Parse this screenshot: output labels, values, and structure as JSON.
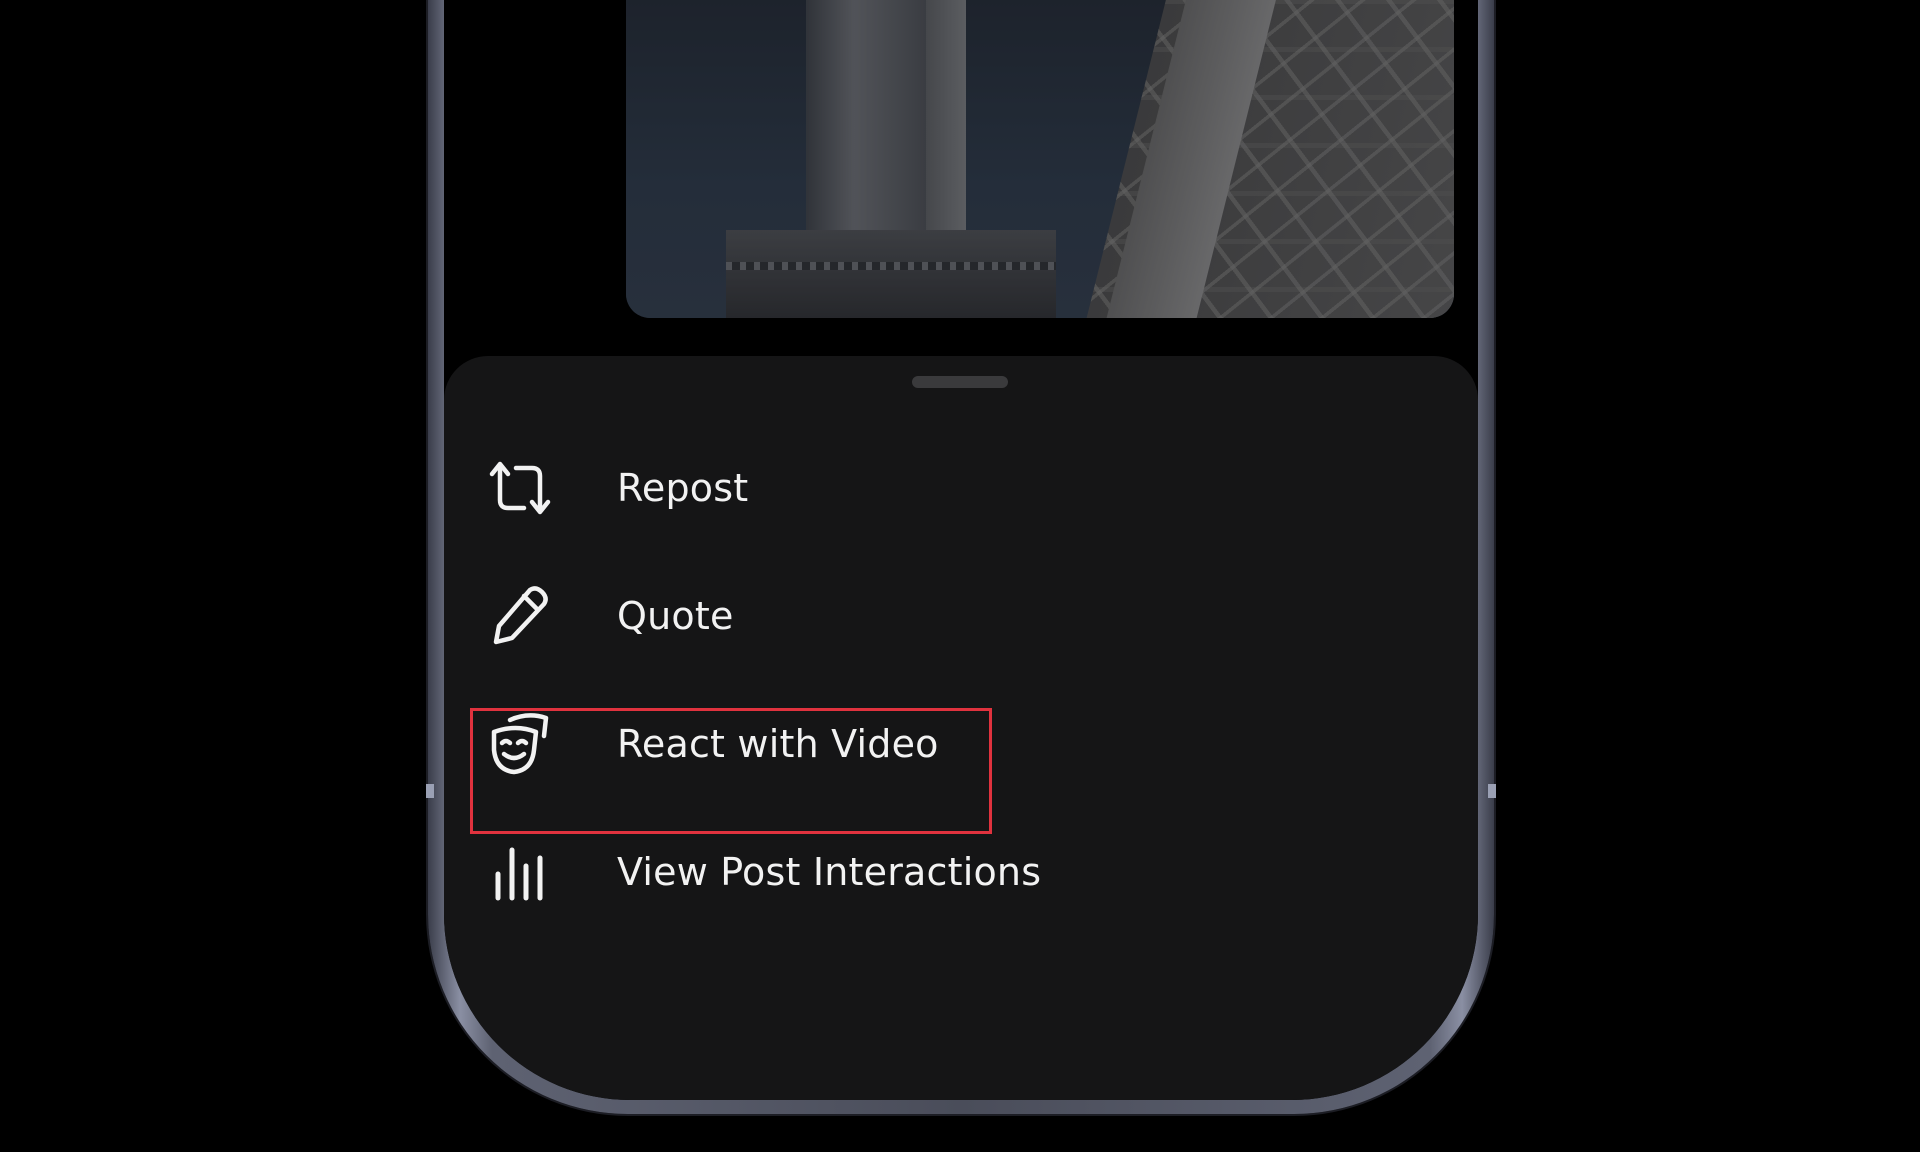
{
  "menu": {
    "items": [
      {
        "label": "Repost",
        "icon": "repost-icon"
      },
      {
        "label": "Quote",
        "icon": "pencil-icon"
      },
      {
        "label": "React with Video",
        "icon": "theater-mask-icon"
      },
      {
        "label": "View Post Interactions",
        "icon": "bar-chart-icon"
      }
    ]
  },
  "colors": {
    "background": "#000000",
    "sheet": "#151516",
    "text": "#f2f2f2",
    "highlight": "#e0323e",
    "grabber": "#3a3a3c"
  }
}
